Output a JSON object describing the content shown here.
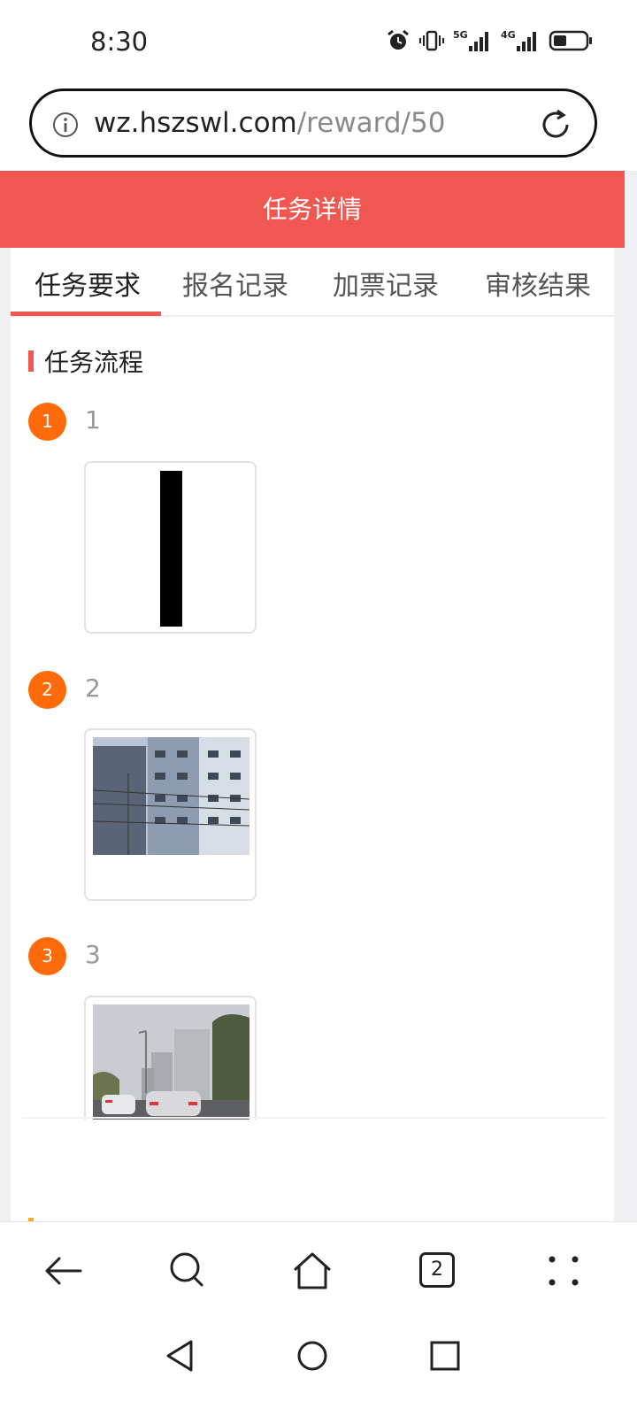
{
  "status_bar": {
    "time": "8:30",
    "icons": [
      "alarm-icon",
      "vibrate-icon",
      "signal-5g-icon",
      "signal-4g-icon",
      "battery-icon"
    ],
    "net1": "5G",
    "net2": "4G"
  },
  "address_bar": {
    "domain": "wz.hszswl.com",
    "path": "/reward/50"
  },
  "header": {
    "title": "任务详情",
    "color": "#ef5750"
  },
  "tabs": [
    {
      "label": "任务要求",
      "active": true
    },
    {
      "label": "报名记录",
      "active": false
    },
    {
      "label": "加票记录",
      "active": false
    },
    {
      "label": "审核结果",
      "active": false
    }
  ],
  "section": {
    "title": "任务流程"
  },
  "steps": [
    {
      "number": "1",
      "label": "1"
    },
    {
      "number": "2",
      "label": "2"
    },
    {
      "number": "3",
      "label": "3"
    }
  ],
  "browser_toolbar": {
    "tab_count": "2",
    "items": [
      "back-icon",
      "search-icon",
      "home-icon",
      "tabs-icon",
      "more-icon"
    ]
  },
  "system_nav": {
    "items": [
      "back-triangle-icon",
      "home-circle-icon",
      "recents-square-icon"
    ]
  },
  "colors": {
    "accent": "#ef5750",
    "step_badge": "#ff6a0a"
  }
}
